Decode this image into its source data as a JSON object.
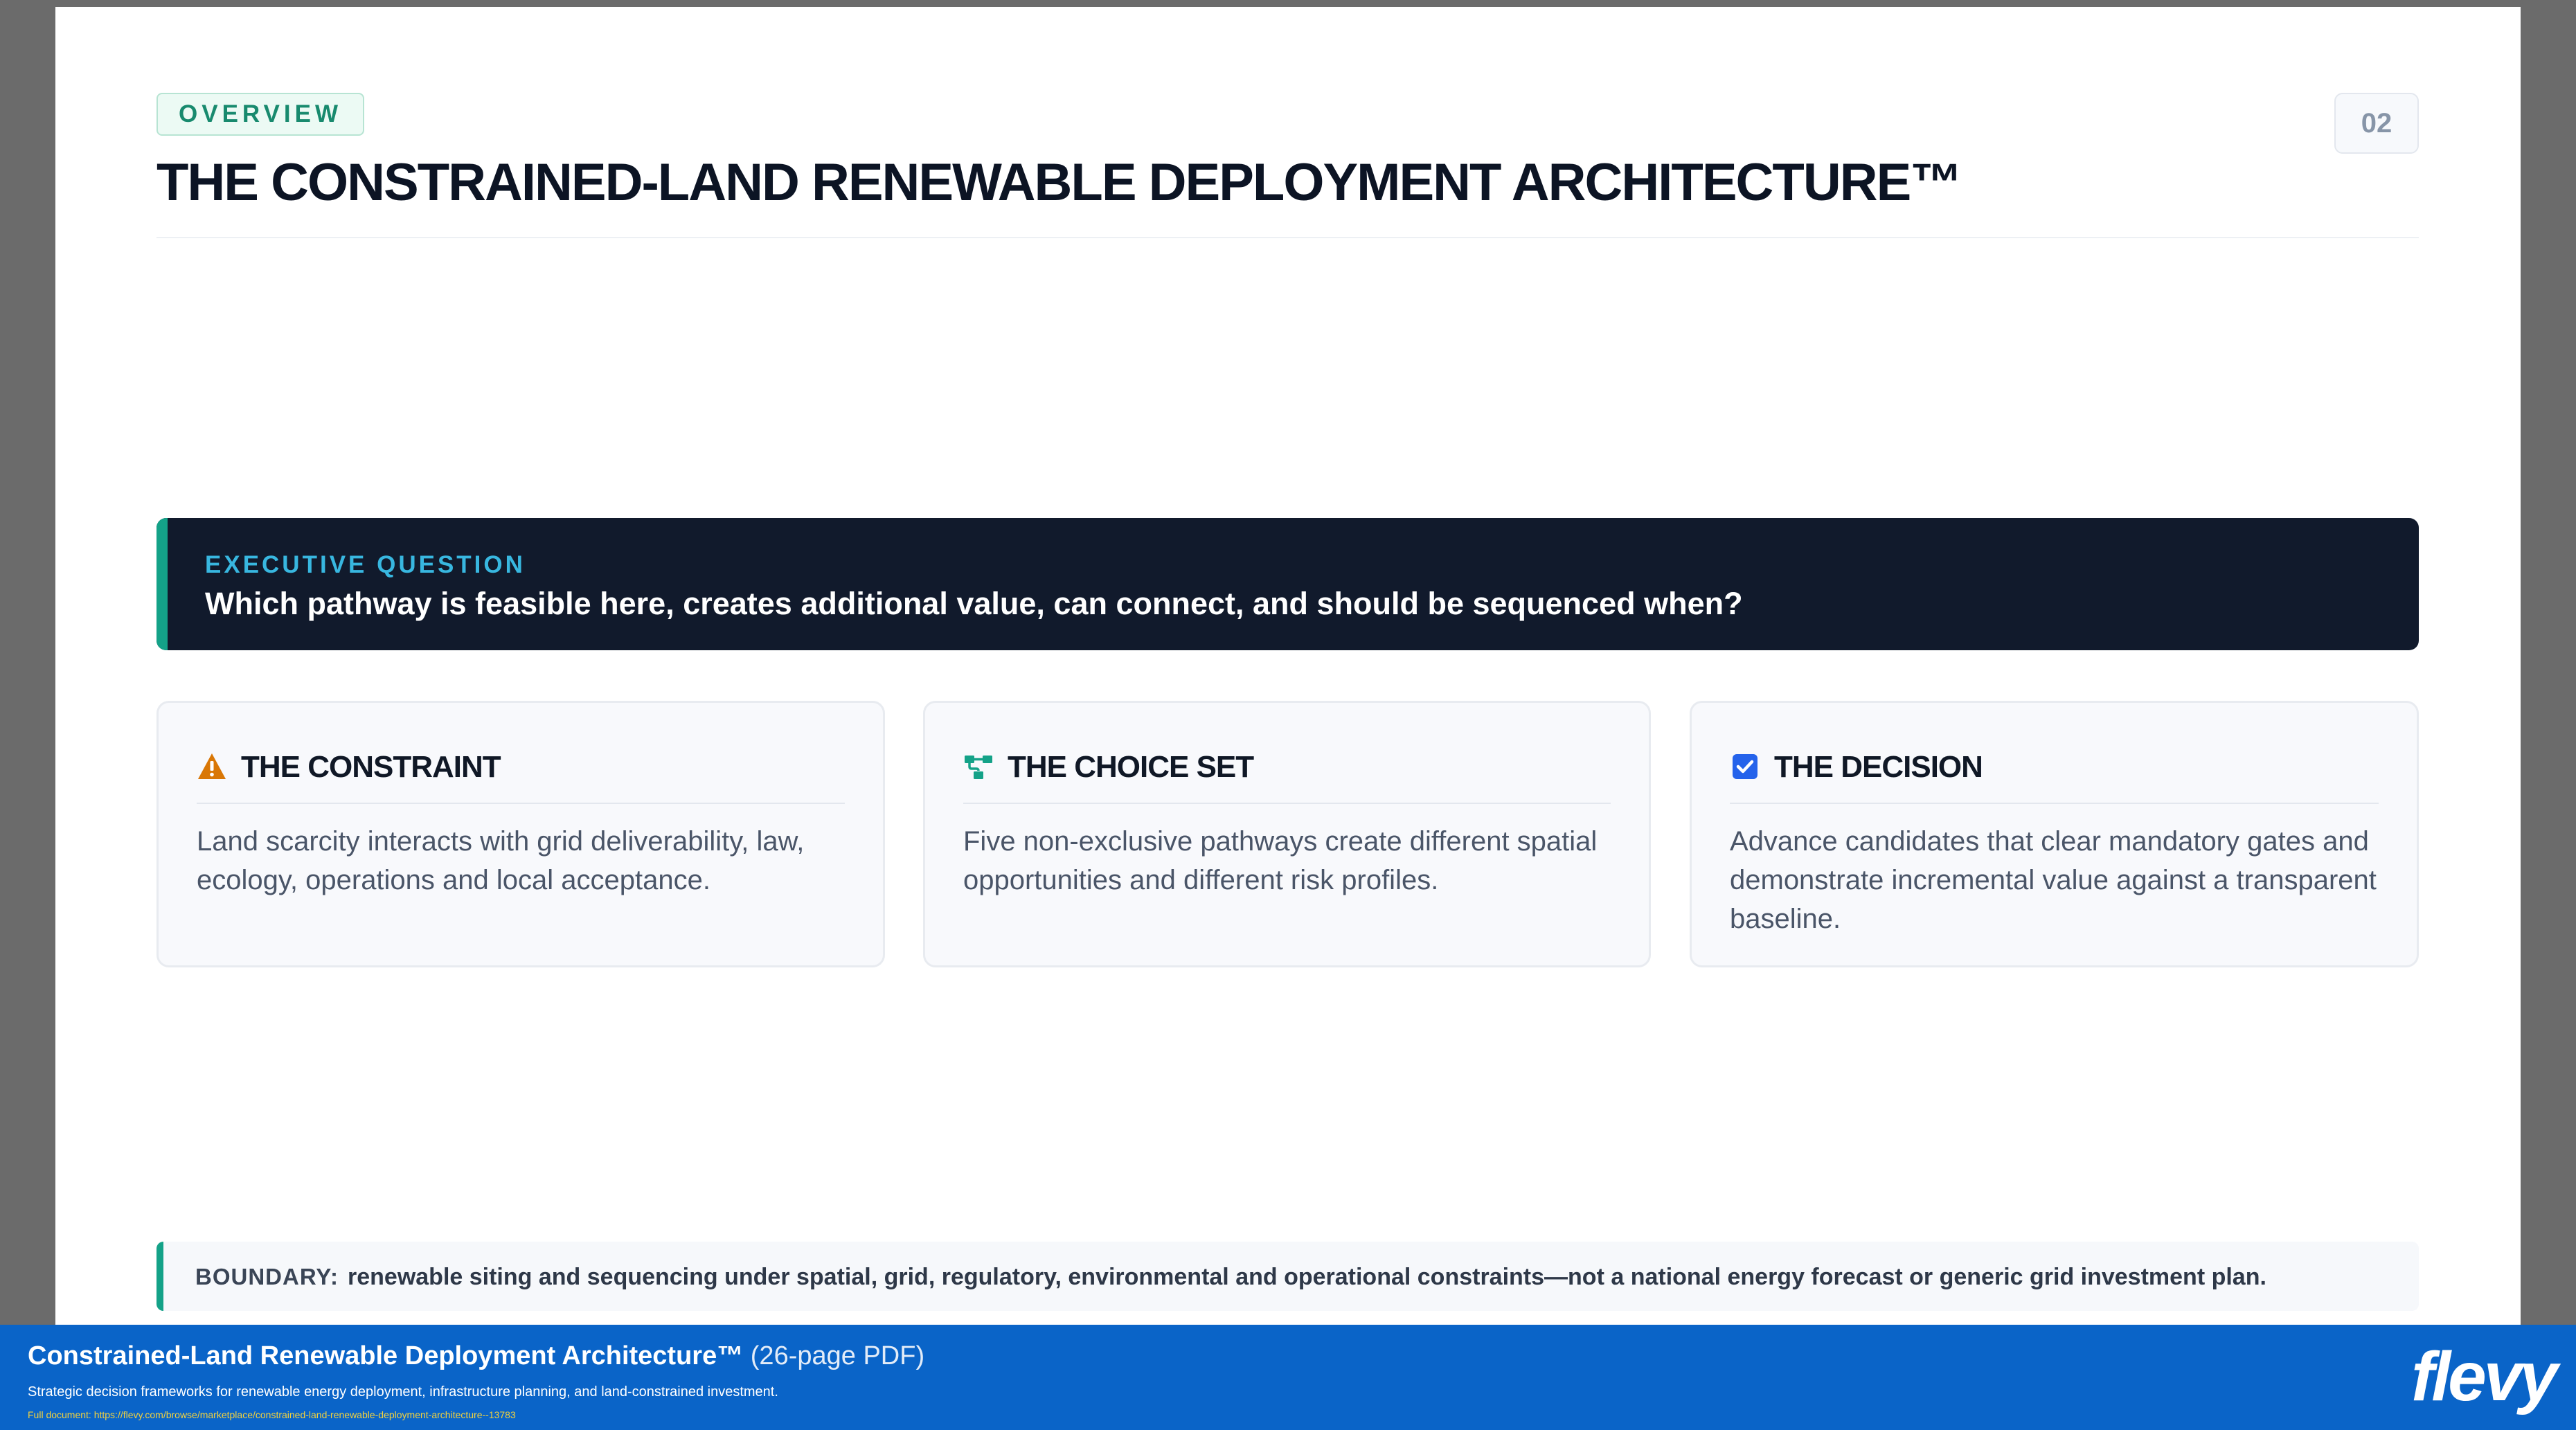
{
  "slide": {
    "tag": "OVERVIEW",
    "page_number": "02",
    "title": "THE CONSTRAINED-LAND RENEWABLE DEPLOYMENT ARCHITECTURE™",
    "executive": {
      "label": "EXECUTIVE QUESTION",
      "question": "Which pathway is feasible here, creates additional value, can connect, and should be sequenced when?"
    },
    "cards": [
      {
        "icon": "warning-icon",
        "title": "THE CONSTRAINT",
        "body": "Land scarcity interacts with grid deliverability, law, ecology, operations and local acceptance."
      },
      {
        "icon": "network-icon",
        "title": "THE CHOICE SET",
        "body": "Five non-exclusive pathways create different spatial opportunities and different risk profiles."
      },
      {
        "icon": "checkbox-icon",
        "title": "THE DECISION",
        "body": "Advance candidates that clear mandatory gates and demonstrate incremental value against a transparent baseline."
      }
    ],
    "boundary": {
      "label": "BOUNDARY:",
      "text": "renewable siting and sequencing under spatial, grid, regulatory, environmental and operational constraints—not a national energy forecast or generic grid investment plan."
    }
  },
  "footer": {
    "title": "Constrained-Land Renewable Deployment Architecture™",
    "title_suffix": "(26-page PDF)",
    "subtitle": "Strategic decision frameworks for renewable energy deployment, infrastructure planning, and land-constrained investment.",
    "link": "Full document: https://flevy.com/browse/marketplace/constrained-land-renewable-deployment-architecture--13783",
    "logo": "flevy"
  },
  "colors": {
    "accent_teal": "#14a288",
    "dark_panel": "#111a2c",
    "question_label": "#38b7e0",
    "warning_orange": "#d97706",
    "checkbox_blue": "#2563eb",
    "footer_blue": "#0a64c8"
  }
}
